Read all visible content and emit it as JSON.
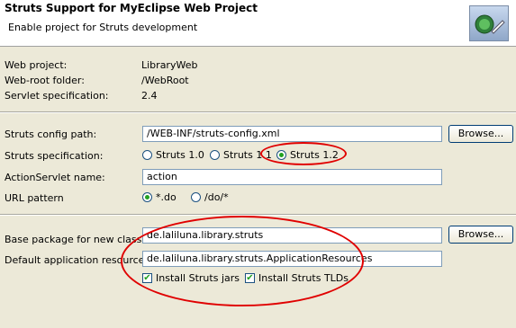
{
  "header": {
    "title": "Struts Support for MyEclipse Web Project",
    "subtitle": "Enable project for Struts development"
  },
  "project_info": {
    "web_project_label": "Web project:",
    "web_project_value": "LibraryWeb",
    "web_root_label": "Web-root folder:",
    "web_root_value": "/WebRoot",
    "servlet_label": "Servlet specification:",
    "servlet_value": "2.4"
  },
  "struts": {
    "config_path_label": "Struts config path:",
    "config_path_value": "/WEB-INF/struts-config.xml",
    "browse_label": "Browse...",
    "spec_label": "Struts specification:",
    "spec_options": [
      "Struts 1.0",
      "Struts 1.1",
      "Struts 1.2"
    ],
    "spec_selected": "Struts 1.2",
    "actionservlet_label": "ActionServlet name:",
    "actionservlet_value": "action",
    "url_pattern_label": "URL pattern",
    "url_pattern_options": [
      "*.do",
      "/do/*"
    ],
    "url_pattern_selected": "*.do"
  },
  "classes": {
    "base_package_label": "Base package for new classes:",
    "base_package_value": "de.laliluna.library.struts",
    "browse_label": "Browse...",
    "resource_label": "Default application resource:",
    "resource_value": "de.laliluna.library.struts.ApplicationResources",
    "install_jars_label": "Install Struts jars",
    "install_jars_checked": true,
    "install_tlds_label": "Install Struts TLDs",
    "install_tlds_checked": true
  },
  "colors": {
    "annotation": "#e00000",
    "background": "#ece9d8"
  }
}
